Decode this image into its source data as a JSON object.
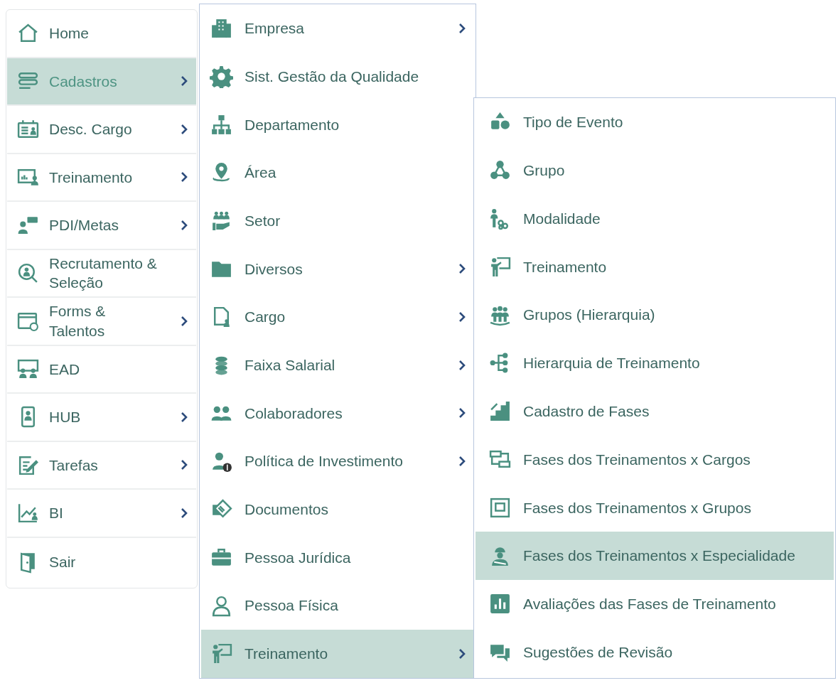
{
  "menus": [
    {
      "items": [
        {
          "label": "Home",
          "submenu": false,
          "selected": false
        },
        {
          "label": "Cadastros",
          "submenu": true,
          "selected": true
        },
        {
          "label": "Desc. Cargo",
          "submenu": true,
          "selected": false
        },
        {
          "label": "Treinamento",
          "submenu": true,
          "selected": false
        },
        {
          "label": "PDI/Metas",
          "submenu": true,
          "selected": false
        },
        {
          "label": "Recrutamento & Seleção",
          "submenu": false,
          "selected": false
        },
        {
          "label": "Forms & Talentos",
          "submenu": true,
          "selected": false
        },
        {
          "label": "EAD",
          "submenu": false,
          "selected": false
        },
        {
          "label": "HUB",
          "submenu": true,
          "selected": false
        },
        {
          "label": "Tarefas",
          "submenu": true,
          "selected": false
        },
        {
          "label": "BI",
          "submenu": true,
          "selected": false
        },
        {
          "label": "Sair",
          "submenu": false,
          "selected": false
        }
      ]
    },
    {
      "items": [
        {
          "label": "Empresa",
          "submenu": true,
          "selected": false
        },
        {
          "label": "Sist. Gestão da Qualidade",
          "submenu": false,
          "selected": false
        },
        {
          "label": "Departamento",
          "submenu": false,
          "selected": false
        },
        {
          "label": "Área",
          "submenu": false,
          "selected": false
        },
        {
          "label": "Setor",
          "submenu": false,
          "selected": false
        },
        {
          "label": "Diversos",
          "submenu": true,
          "selected": false
        },
        {
          "label": "Cargo",
          "submenu": true,
          "selected": false
        },
        {
          "label": "Faixa Salarial",
          "submenu": true,
          "selected": false
        },
        {
          "label": "Colaboradores",
          "submenu": true,
          "selected": false
        },
        {
          "label": "Política de Investimento",
          "submenu": true,
          "selected": false
        },
        {
          "label": "Documentos",
          "submenu": false,
          "selected": false
        },
        {
          "label": "Pessoa Jurídica",
          "submenu": false,
          "selected": false
        },
        {
          "label": "Pessoa Física",
          "submenu": false,
          "selected": false
        },
        {
          "label": "Treinamento",
          "submenu": true,
          "selected": true
        }
      ]
    },
    {
      "items": [
        {
          "label": "Tipo de Evento",
          "submenu": false,
          "selected": false
        },
        {
          "label": "Grupo",
          "submenu": false,
          "selected": false
        },
        {
          "label": "Modalidade",
          "submenu": false,
          "selected": false
        },
        {
          "label": "Treinamento",
          "submenu": false,
          "selected": false
        },
        {
          "label": "Grupos (Hierarquia)",
          "submenu": false,
          "selected": false
        },
        {
          "label": "Hierarquia de Treinamento",
          "submenu": false,
          "selected": false
        },
        {
          "label": "Cadastro de Fases",
          "submenu": false,
          "selected": false
        },
        {
          "label": "Fases dos Treinamentos x Cargos",
          "submenu": false,
          "selected": false
        },
        {
          "label": "Fases dos Treinamentos x Grupos",
          "submenu": false,
          "selected": false
        },
        {
          "label": "Fases dos Treinamentos x Especialidade",
          "submenu": false,
          "selected": true
        },
        {
          "label": "Avaliações das Fases de Treinamento",
          "submenu": false,
          "selected": false
        },
        {
          "label": "Sugestões de Revisão",
          "submenu": false,
          "selected": false
        }
      ]
    }
  ]
}
